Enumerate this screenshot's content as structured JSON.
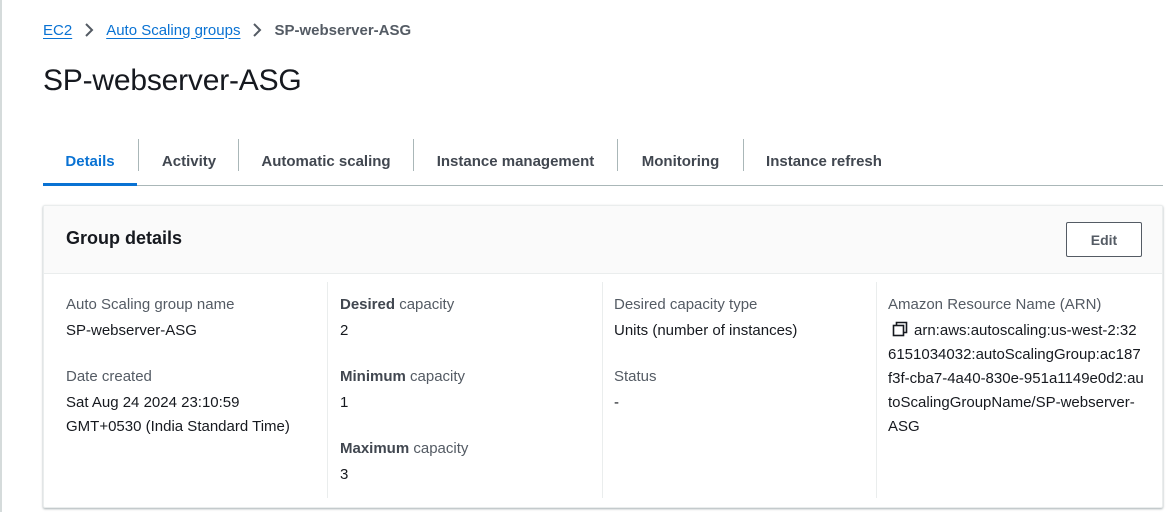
{
  "breadcrumb": {
    "items": [
      "EC2",
      "Auto Scaling groups"
    ],
    "current": "SP-webserver-ASG"
  },
  "page_title": "SP-webserver-ASG",
  "tabs": [
    "Details",
    "Activity",
    "Automatic scaling",
    "Instance management",
    "Monitoring",
    "Instance refresh"
  ],
  "active_tab": "Details",
  "group_details": {
    "title": "Group details",
    "edit_label": "Edit",
    "name_label": "Auto Scaling group name",
    "name_value": "SP-webserver-ASG",
    "date_label": "Date created",
    "date_line1": "Sat Aug 24 2024 23:10:59",
    "date_line2": "GMT+0530 (India Standard Time)",
    "desired_bold": "Desired",
    "desired_rest": " capacity",
    "desired_value": "2",
    "minimum_bold": "Minimum",
    "minimum_rest": " capacity",
    "minimum_value": "1",
    "maximum_bold": "Maximum",
    "maximum_rest": " capacity",
    "maximum_value": "3",
    "capacity_type_label": "Desired capacity type",
    "capacity_type_value": "Units (number of instances)",
    "status_label": "Status",
    "status_value": "-",
    "arn_label": "Amazon Resource Name (ARN)",
    "arn_value": "arn:aws:autoscaling:us-west-2:326151034032:autoScalingGroup:ac187f3f-cba7-4a40-830e-951a1149e0d2:autoScalingGroupName/SP-webserver-ASG"
  },
  "colors": {
    "link": "#0972d3",
    "text": "#16191f",
    "label": "#545b64"
  },
  "icons": {
    "breadcrumb_separator": "chevron-right-icon",
    "copy": "copy-icon"
  }
}
